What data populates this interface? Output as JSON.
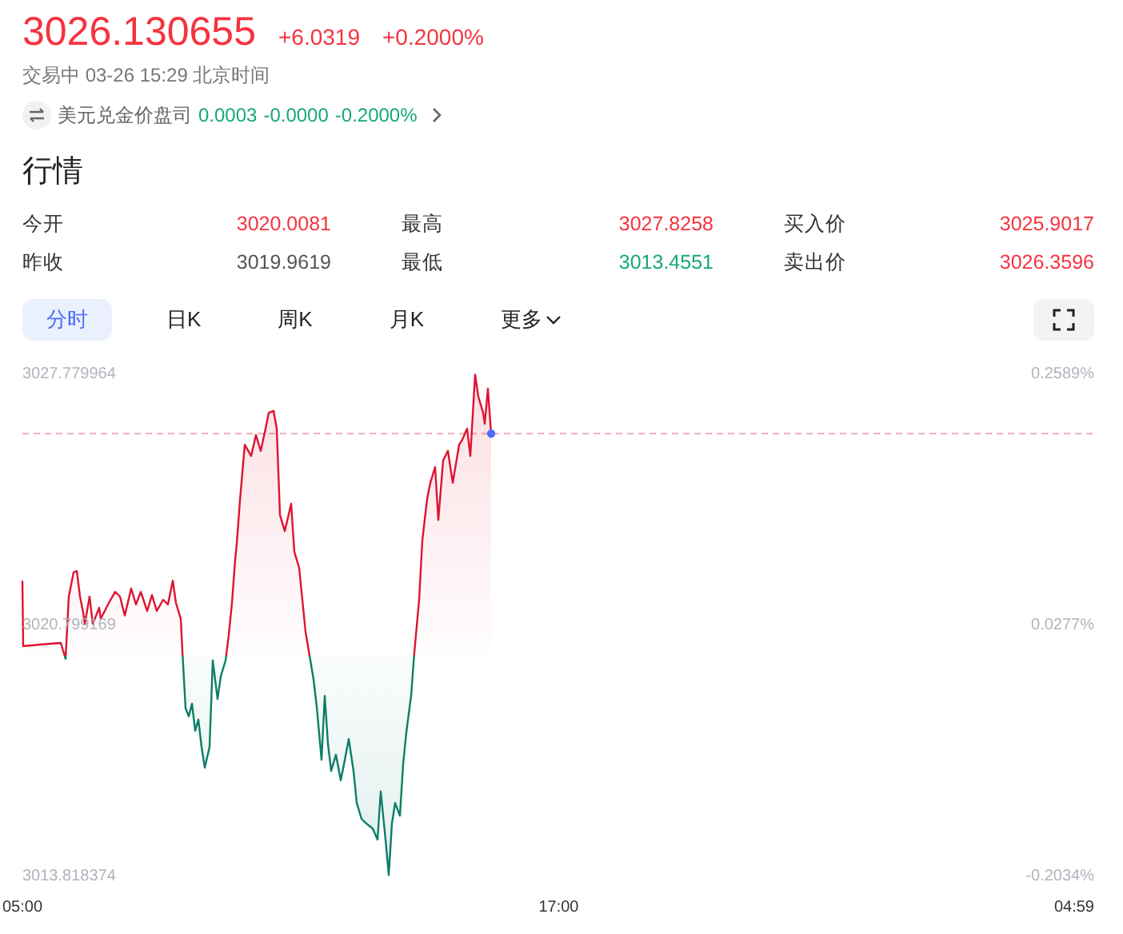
{
  "quote": {
    "price": "3026.130655",
    "change": "+6.0319",
    "change_pct": "+0.2000%",
    "status": "交易中 03-26 15:29 北京时间"
  },
  "related": {
    "name": "美元兑金价盘司",
    "price": "0.0003",
    "change": "-0.0000",
    "change_pct": "-0.2000%"
  },
  "section_title": "行情",
  "stats": [
    {
      "label": "今开",
      "value": "3020.0081",
      "color": "#f5333f"
    },
    {
      "label": "最高",
      "value": "3027.8258",
      "color": "#f5333f"
    },
    {
      "label": "买入价",
      "value": "3025.9017",
      "color": "#f5333f"
    },
    {
      "label": "昨收",
      "value": "3019.9619",
      "color": "#555555"
    },
    {
      "label": "最低",
      "value": "3013.4551",
      "color": "#14a874"
    },
    {
      "label": "卖出价",
      "value": "3026.3596",
      "color": "#f5333f"
    }
  ],
  "periods": [
    {
      "label": "分时",
      "kind": "tab",
      "selected": true
    },
    {
      "label": "日K",
      "kind": "tab",
      "selected": false
    },
    {
      "label": "周K",
      "kind": "tab",
      "selected": false
    },
    {
      "label": "月K",
      "kind": "tab",
      "selected": false
    },
    {
      "label": "更多",
      "kind": "dropdown",
      "selected": false
    }
  ],
  "chart": {
    "right_labels": [
      "0.2589%",
      "0.0277%",
      "-0.2034%"
    ],
    "end_time_label": "04:59",
    "chart_data": {
      "type": "area",
      "xlim": [
        5,
        28.9833
      ],
      "ylim": [
        3013.818374,
        3027.779964
      ],
      "xticks": [
        {
          "value": 5,
          "label": "05:00"
        },
        {
          "value": 17,
          "label": "17:00"
        }
      ],
      "yticks": [
        {
          "value": 3027.779964,
          "label": "3027.779964"
        },
        {
          "value": 3020.799169,
          "label": "3020.799169"
        },
        {
          "value": 3013.818374,
          "label": "3013.818374"
        }
      ],
      "ref_lines": [
        {
          "axis": "y",
          "value": 3026.13
        }
      ],
      "x": [
        5.0,
        5.018,
        5.465,
        5.859,
        5.967,
        6.038,
        6.146,
        6.217,
        6.289,
        6.36,
        6.396,
        6.504,
        6.575,
        6.718,
        6.754,
        6.933,
        7.076,
        7.184,
        7.291,
        7.434,
        7.542,
        7.649,
        7.792,
        7.9,
        8.007,
        8.15,
        8.258,
        8.365,
        8.437,
        8.544,
        8.58,
        8.652,
        8.723,
        8.795,
        8.866,
        8.938,
        9.01,
        9.081,
        9.189,
        9.26,
        9.368,
        9.439,
        9.547,
        9.618,
        9.69,
        9.761,
        9.797,
        9.869,
        9.976,
        10.119,
        10.227,
        10.334,
        10.442,
        10.513,
        10.621,
        10.692,
        10.764,
        10.871,
        11.014,
        11.086,
        11.193,
        11.265,
        11.337,
        11.408,
        11.516,
        11.587,
        11.695,
        11.766,
        11.838,
        11.909,
        12.017,
        12.124,
        12.196,
        12.303,
        12.411,
        12.482,
        12.59,
        12.697,
        12.84,
        12.948,
        13.019,
        13.127,
        13.198,
        13.27,
        13.341,
        13.449,
        13.52,
        13.592,
        13.699,
        13.771,
        13.878,
        13.95,
        14.057,
        14.129,
        14.236,
        14.308,
        14.415,
        14.523,
        14.63,
        14.773,
        14.845,
        14.952,
        15.024,
        15.131,
        15.203,
        15.31,
        15.346,
        15.418,
        15.489
      ],
      "values": [
        3022.04,
        3020.22,
        3020.27,
        3020.31,
        3019.87,
        3021.6,
        3022.27,
        3022.31,
        3021.6,
        3021.16,
        3020.84,
        3021.6,
        3020.84,
        3021.29,
        3020.98,
        3021.42,
        3021.73,
        3021.6,
        3021.07,
        3021.82,
        3021.38,
        3021.73,
        3021.2,
        3021.64,
        3021.2,
        3021.51,
        3021.38,
        3022.04,
        3021.42,
        3020.98,
        3020.09,
        3018.49,
        3018.27,
        3018.62,
        3017.87,
        3018.18,
        3017.42,
        3016.84,
        3017.42,
        3019.82,
        3018.75,
        3019.38,
        3019.82,
        3020.53,
        3021.42,
        3022.62,
        3023.07,
        3024.27,
        3025.82,
        3025.51,
        3026.09,
        3025.65,
        3026.27,
        3026.71,
        3026.76,
        3026.27,
        3023.87,
        3023.42,
        3024.18,
        3022.84,
        3022.4,
        3021.51,
        3020.62,
        3020.09,
        3019.29,
        3018.53,
        3017.06,
        3018.84,
        3017.51,
        3016.75,
        3017.2,
        3016.49,
        3016.93,
        3017.64,
        3016.75,
        3015.86,
        3015.42,
        3015.29,
        3015.15,
        3014.84,
        3016.18,
        3014.84,
        3013.86,
        3015.29,
        3015.86,
        3015.51,
        3016.93,
        3017.82,
        3018.84,
        3020.04,
        3021.51,
        3023.16,
        3024.31,
        3024.76,
        3025.2,
        3023.73,
        3025.38,
        3025.65,
        3024.76,
        3025.82,
        3025.96,
        3026.27,
        3025.51,
        3027.77,
        3027.16,
        3026.71,
        3026.4,
        3027.38,
        3026.13
      ]
    }
  }
}
